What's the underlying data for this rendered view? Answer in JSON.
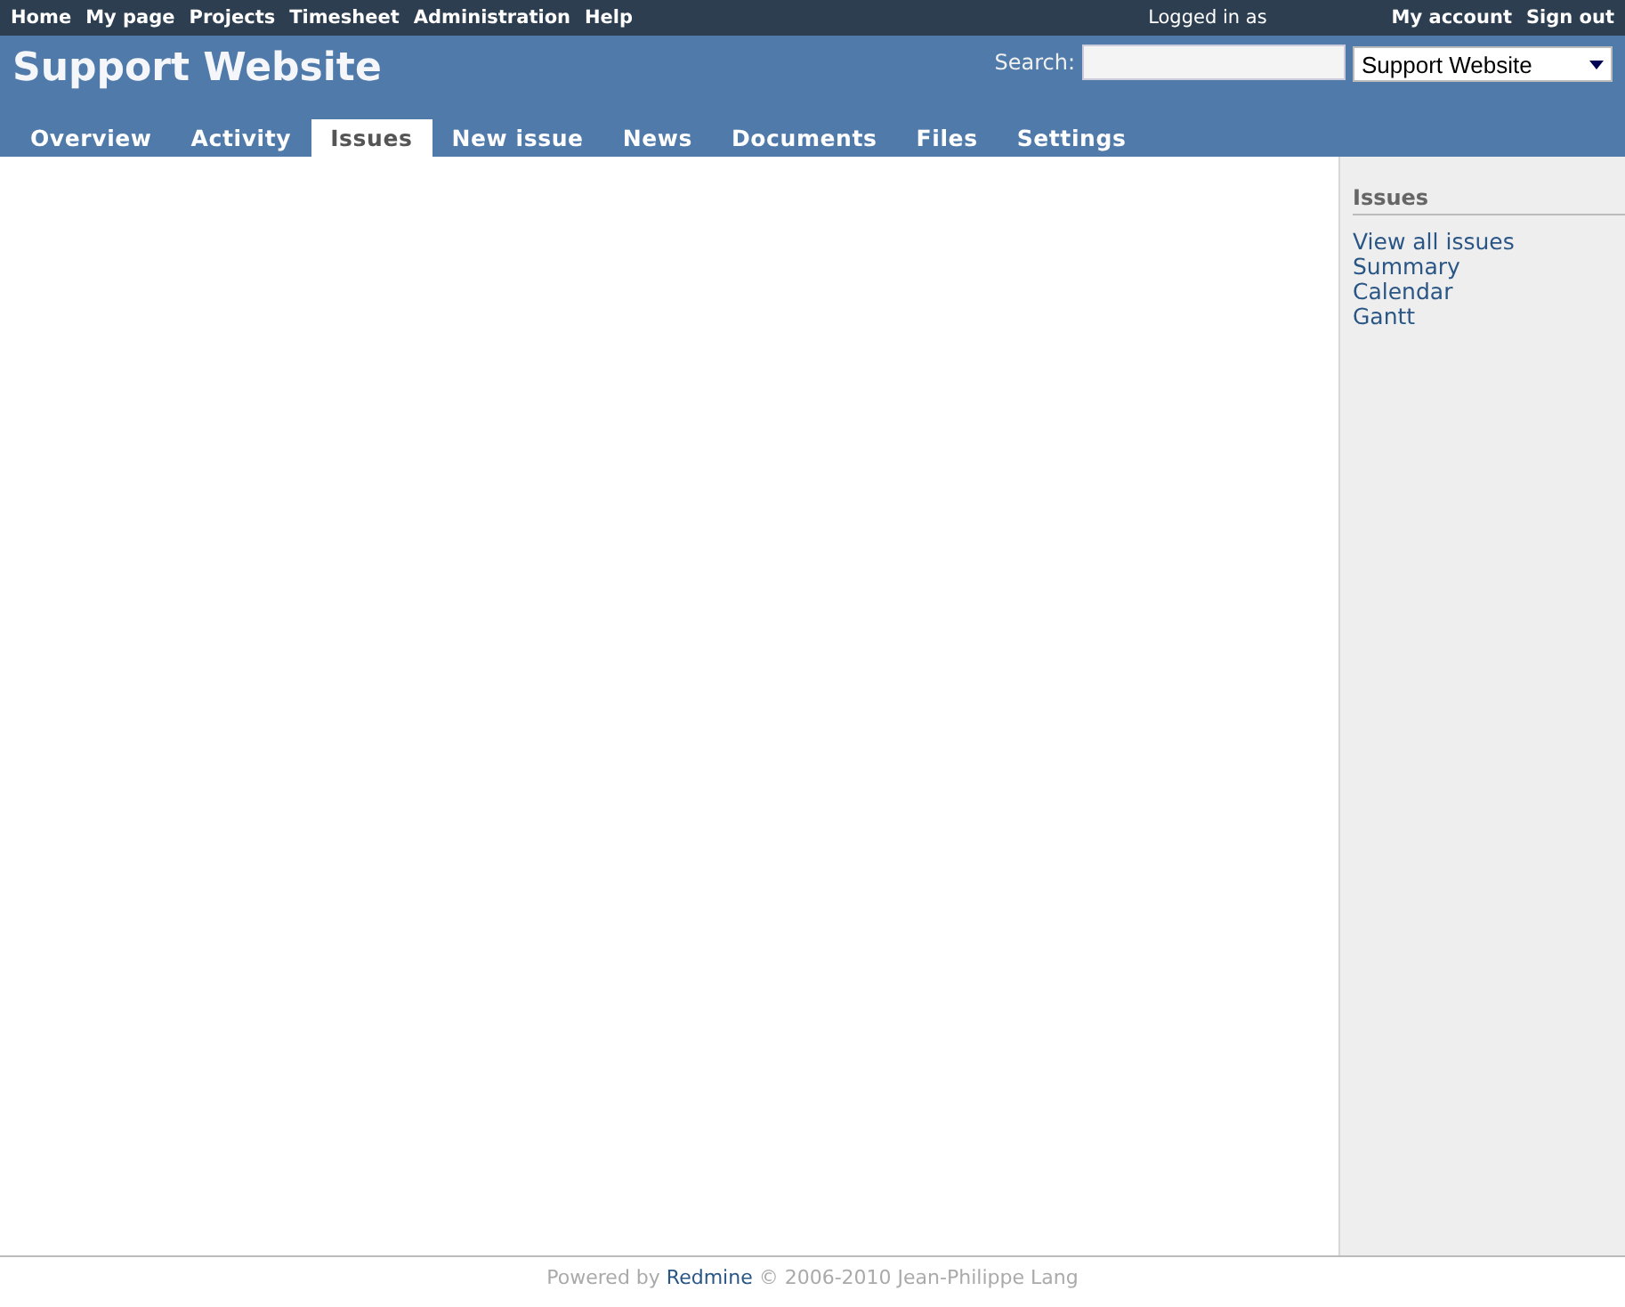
{
  "top_menu": {
    "items": [
      "Home",
      "My page",
      "Projects",
      "Timesheet",
      "Administration",
      "Help"
    ],
    "logged_in": "Logged in as",
    "account_items": [
      "My account",
      "Sign out"
    ]
  },
  "header": {
    "title": "Support Website",
    "search_label": "Search:",
    "project_select": "Support Website"
  },
  "tabs": [
    {
      "label": "Overview",
      "selected": false
    },
    {
      "label": "Activity",
      "selected": false
    },
    {
      "label": "Issues",
      "selected": true
    },
    {
      "label": "New issue",
      "selected": false
    },
    {
      "label": "News",
      "selected": false
    },
    {
      "label": "Documents",
      "selected": false
    },
    {
      "label": "Files",
      "selected": false
    },
    {
      "label": "Settings",
      "selected": false
    }
  ],
  "sidebar": {
    "title": "Issues",
    "links": [
      "View all issues",
      "Summary",
      "Calendar",
      "Gantt"
    ]
  },
  "footer": {
    "before": "Powered by",
    "link": "Redmine",
    "after": "© 2006-2010 Jean-Philippe Lang"
  }
}
